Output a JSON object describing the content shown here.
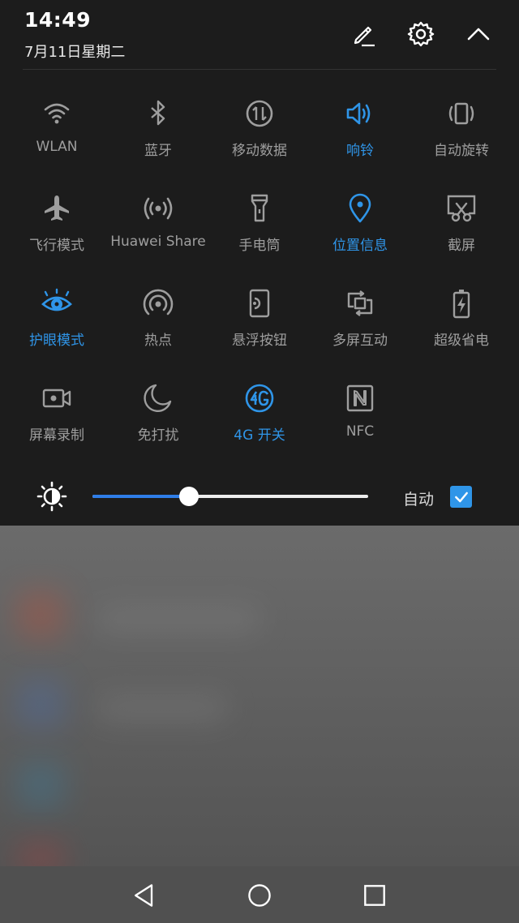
{
  "status": {
    "time": "14:49",
    "date": "7月11日星期二"
  },
  "header_icons": [
    "edit-icon",
    "settings-icon",
    "collapse-icon"
  ],
  "tiles": [
    {
      "label": "WLAN",
      "icon": "wifi-icon",
      "active": false
    },
    {
      "label": "蓝牙",
      "icon": "bluetooth-icon",
      "active": false
    },
    {
      "label": "移动数据",
      "icon": "mobile-data-icon",
      "active": false
    },
    {
      "label": "响铃",
      "icon": "ring-icon",
      "active": true
    },
    {
      "label": "自动旋转",
      "icon": "auto-rotate-icon",
      "active": false
    },
    {
      "label": "飞行模式",
      "icon": "airplane-icon",
      "active": false
    },
    {
      "label": "Huawei Share",
      "icon": "huawei-share-icon",
      "active": false
    },
    {
      "label": "手电筒",
      "icon": "flashlight-icon",
      "active": false
    },
    {
      "label": "位置信息",
      "icon": "location-icon",
      "active": true
    },
    {
      "label": "截屏",
      "icon": "screenshot-icon",
      "active": false
    },
    {
      "label": "护眼模式",
      "icon": "eye-comfort-icon",
      "active": true
    },
    {
      "label": "热点",
      "icon": "hotspot-icon",
      "active": false
    },
    {
      "label": "悬浮按钮",
      "icon": "floating-button-icon",
      "active": false
    },
    {
      "label": "多屏互动",
      "icon": "multi-screen-icon",
      "active": false
    },
    {
      "label": "超级省电",
      "icon": "battery-saver-icon",
      "active": false
    },
    {
      "label": "屏幕录制",
      "icon": "screen-record-icon",
      "active": false
    },
    {
      "label": "免打扰",
      "icon": "do-not-disturb-icon",
      "active": false
    },
    {
      "label": "4G 开关",
      "icon": "4g-icon",
      "active": true
    },
    {
      "label": "NFC",
      "icon": "nfc-icon",
      "active": false
    }
  ],
  "brightness": {
    "level": 0.35,
    "auto_label": "自动",
    "auto_checked": true
  },
  "colors": {
    "accent": "#2f95e8",
    "inactive": "#9e9e9e",
    "panel": "#1c1c1c"
  },
  "nav": [
    "back-icon",
    "home-icon",
    "recents-icon"
  ]
}
